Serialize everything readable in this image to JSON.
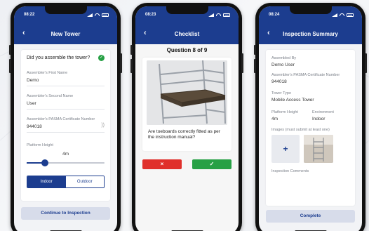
{
  "colors": {
    "primary": "#1c3d8f",
    "success": "#27a045",
    "danger": "#e0302b"
  },
  "phone1": {
    "time": "08:22",
    "title": "New Tower",
    "question": "Did you assemble the tower?",
    "first_name_label": "Assembler's First Name",
    "first_name_value": "Demo",
    "second_name_label": "Assembler's Second Name",
    "second_name_value": "User",
    "pasma_label": "Assembler's PASMA Certificate Number",
    "pasma_value": "944018",
    "height_label": "Platform Height",
    "height_value": "4m",
    "height_level": 0.3,
    "indoor_label": "Indoor",
    "outdoor_label": "Outdoor",
    "continue_label": "Continue to Inspection"
  },
  "phone2": {
    "time": "08:23",
    "title": "Checklist",
    "question_counter": "Question 8 of 9",
    "question": "Are toeboards correctly fitted as per the instruction manual?",
    "no_icon": "×",
    "yes_icon": "✓"
  },
  "phone3": {
    "time": "08:24",
    "title": "Inspection Summary",
    "assembled_by_label": "Assembled By",
    "assembled_by_value": "Demo User",
    "pasma_label": "Assembler's PASMA Certificate Number",
    "pasma_value": "944018",
    "tower_type_label": "Tower Type",
    "tower_type_value": "Mobile Access Tower",
    "height_label": "Platform Height",
    "height_value": "4m",
    "env_label": "Environment",
    "env_value": "Indoor",
    "images_label": "Images (must submit at least one)",
    "add_icon": "+",
    "comments_label": "Inspection Comments",
    "complete_label": "Complete"
  }
}
